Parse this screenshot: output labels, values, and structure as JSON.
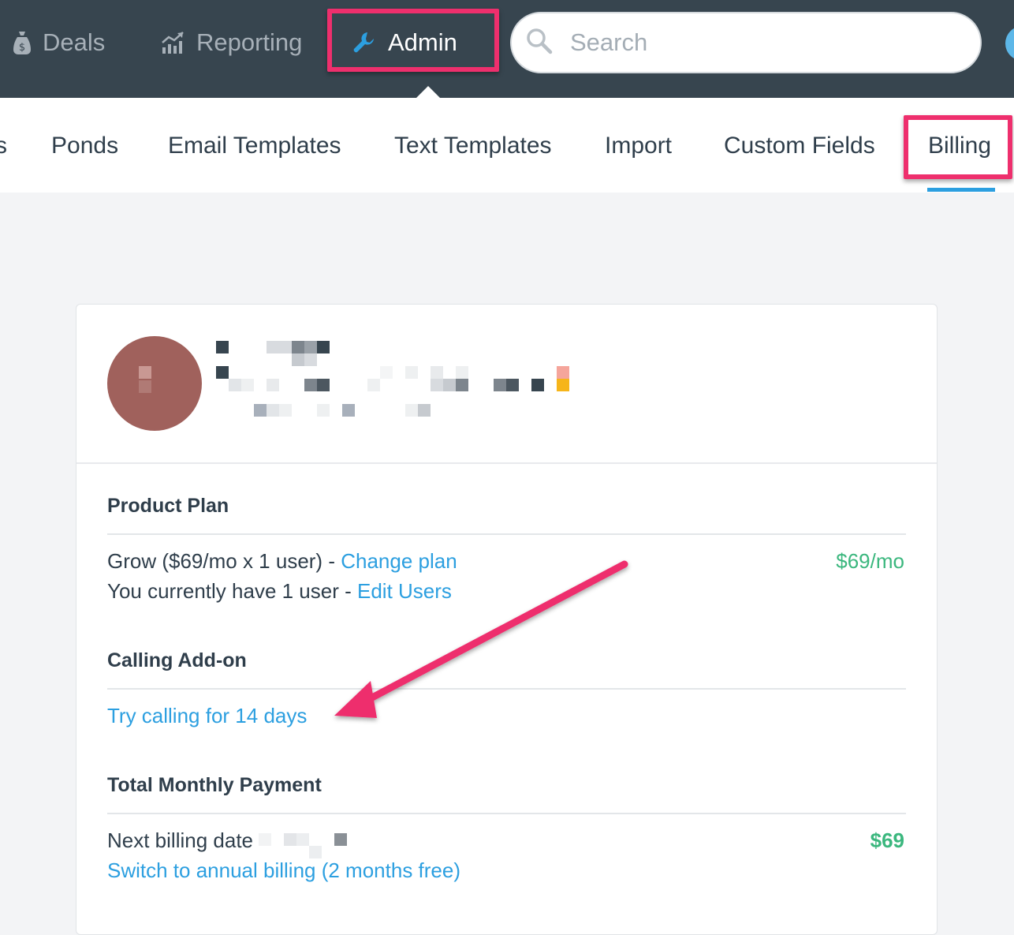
{
  "topnav": {
    "deals_label": "Deals",
    "reporting_label": "Reporting",
    "admin_label": "Admin",
    "search_placeholder": "Search"
  },
  "subnav": {
    "partial_label": "s",
    "items": [
      {
        "label": "Ponds"
      },
      {
        "label": "Email Templates"
      },
      {
        "label": "Text Templates"
      },
      {
        "label": "Import"
      },
      {
        "label": "Custom Fields"
      },
      {
        "label": "Billing",
        "active": true
      }
    ]
  },
  "billing": {
    "product_plan": {
      "title": "Product Plan",
      "plan_text": "Grow ($69/mo x 1 user) - ",
      "change_plan_link": "Change plan",
      "price": "$69/mo",
      "users_text": "You currently have 1 user - ",
      "edit_users_link": "Edit Users"
    },
    "calling_addon": {
      "title": "Calling Add-on",
      "trial_link": "Try calling for 14 days"
    },
    "total_payment": {
      "title": "Total Monthly Payment",
      "next_billing_label": "Next billing date",
      "amount": "$69",
      "annual_link": "Switch to annual billing (2 months free)"
    }
  },
  "colors": {
    "nav_bg": "#37454f",
    "highlight": "#ee2f6d",
    "link": "#2c9fe0",
    "price": "#3bb77e",
    "avatar": "#a0615c"
  },
  "icons": [
    "deals-icon",
    "reporting-icon",
    "wrench-icon",
    "search-icon"
  ]
}
